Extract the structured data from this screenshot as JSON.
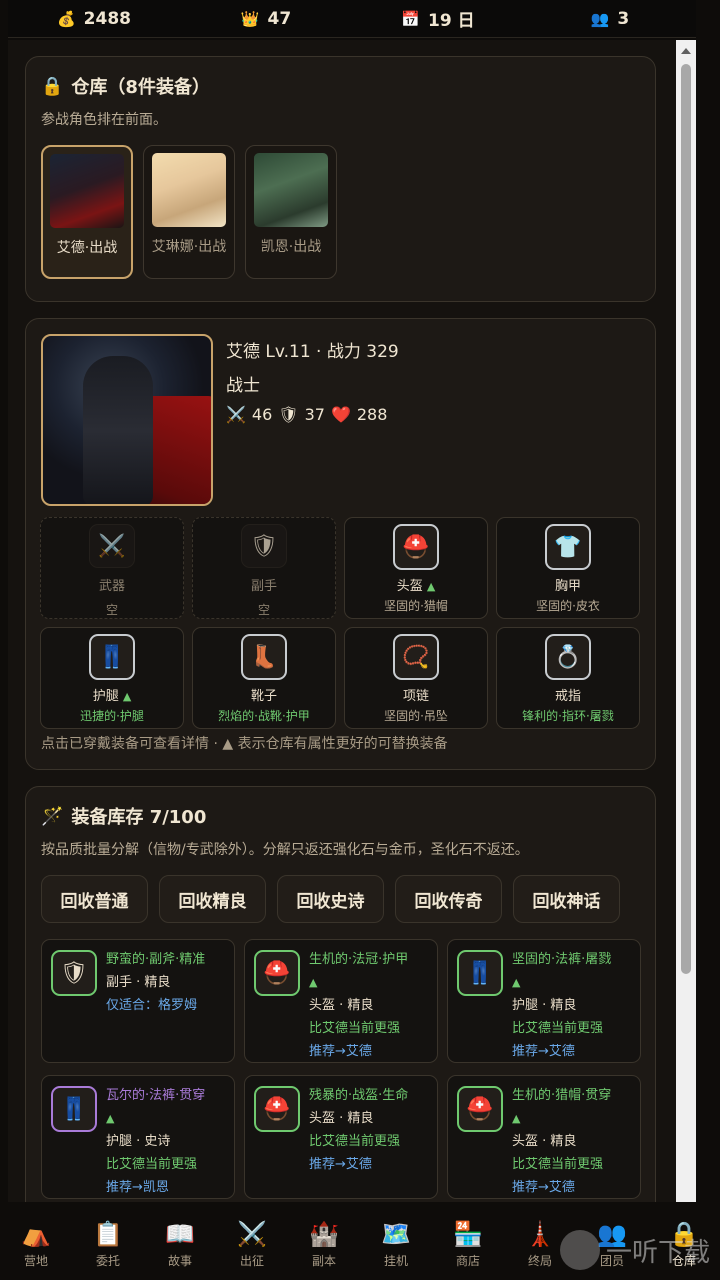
{
  "topbar": {
    "gold": {
      "icon": "💰",
      "value": "2488"
    },
    "crown": {
      "icon": "👑",
      "value": "47"
    },
    "day": {
      "icon": "📅",
      "value": "19 日"
    },
    "members": {
      "icon": "👥",
      "value": "3"
    }
  },
  "warehouse": {
    "icon": "🔒",
    "title": "仓库（8件装备）",
    "subtitle": "参战角色排在前面。",
    "heroes": [
      {
        "label": "艾德·出战"
      },
      {
        "label": "艾琳娜·出战"
      },
      {
        "label": "凯恩·出战"
      }
    ]
  },
  "character": {
    "line1": "艾德 Lv.11 · 战力 329",
    "class": "战士",
    "atk_icon": "⚔️",
    "atk": "46",
    "def_icon": "🛡",
    "def": "37",
    "hp_icon": "❤️",
    "hp": "288",
    "slots": [
      {
        "icon": "⚔️",
        "name": "武器",
        "item": "空",
        "up": ""
      },
      {
        "icon": "🛡",
        "name": "副手",
        "item": "空",
        "up": ""
      },
      {
        "icon": "⛑️",
        "name": "头盔",
        "item": "坚固的·猎帽",
        "up": "▲"
      },
      {
        "icon": "👕",
        "name": "胸甲",
        "item": "坚固的·皮衣",
        "up": ""
      },
      {
        "icon": "👖",
        "name": "护腿",
        "item": "迅捷的·护腿",
        "up": "▲"
      },
      {
        "icon": "👢",
        "name": "靴子",
        "item": "烈焰的·战靴·护甲",
        "up": ""
      },
      {
        "icon": "📿",
        "name": "项链",
        "item": "坚固的·吊坠",
        "up": ""
      },
      {
        "icon": "💍",
        "name": "戒指",
        "item": "锋利的·指环·屠戮",
        "up": ""
      }
    ],
    "hint": "点击已穿戴装备可查看详情 · ▲ 表示仓库有属性更好的可替换装备"
  },
  "inventory": {
    "icon": "🪄",
    "title": "装备库存 7/100",
    "subtitle": "按品质批量分解（信物/专武除外）。分解只返还强化石与金币，圣化石不返还。",
    "buttons": [
      "回收普通",
      "回收精良",
      "回收史诗",
      "回收传奇",
      "回收神话"
    ],
    "items": [
      {
        "icon": "🛡",
        "name": "野蛮的·副斧·精准",
        "up": "",
        "type": "副手 · 精良",
        "cmp": "仅适合：格罗姆",
        "rec": ""
      },
      {
        "icon": "⛑️",
        "name": "生机的·法冠·护甲",
        "up": "▲",
        "type": "头盔 · 精良",
        "cmp": "比艾德当前更强",
        "rec": "推荐→艾德"
      },
      {
        "icon": "👖",
        "name": "坚固的·法裤·屠戮",
        "up": "▲",
        "type": "护腿 · 精良",
        "cmp": "比艾德当前更强",
        "rec": "推荐→艾德"
      },
      {
        "icon": "👖",
        "name": "瓦尔的·法裤·贯穿",
        "up": "▲",
        "type": "护腿 · 史诗",
        "cmp": "比艾德当前更强",
        "rec": "推荐→凯恩"
      },
      {
        "icon": "⛑️",
        "name": "残暴的·战盔·生命",
        "up": "",
        "type": "头盔 · 精良",
        "cmp": "比艾德当前更强",
        "rec": "推荐→艾德"
      },
      {
        "icon": "⛑️",
        "name": "生机的·猎帽·贯穿",
        "up": "▲",
        "type": "头盔 · 精良",
        "cmp": "比艾德当前更强",
        "rec": "推荐→艾德"
      }
    ]
  },
  "nav": [
    {
      "icon": "⛺",
      "label": "营地"
    },
    {
      "icon": "📋",
      "label": "委托"
    },
    {
      "icon": "📖",
      "label": "故事"
    },
    {
      "icon": "⚔️",
      "label": "出征"
    },
    {
      "icon": "🏰",
      "label": "副本"
    },
    {
      "icon": "🗺️",
      "label": "挂机"
    },
    {
      "icon": "🏪",
      "label": "商店"
    },
    {
      "icon": "🗼",
      "label": "终局"
    },
    {
      "icon": "👥",
      "label": "团员"
    },
    {
      "icon": "🔒",
      "label": "仓库"
    }
  ],
  "watermark": "一听下载"
}
